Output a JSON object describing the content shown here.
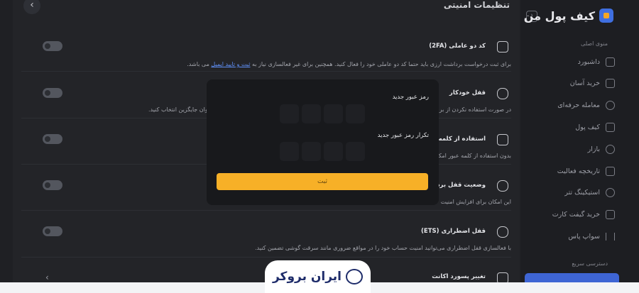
{
  "header": {
    "page_title": "تنظیمات امنیتی",
    "back_icon": "chevron-left-icon",
    "brand_name": "کیف پول من",
    "collapse_icon": "chevron-right-icon"
  },
  "sidebar": {
    "section_title": "منوی اصلی",
    "items": [
      {
        "label": "داشبورد",
        "icon": "grid-icon"
      },
      {
        "label": "خرید آسان",
        "icon": "chart-icon"
      },
      {
        "label": "معامله حرفه‌ای",
        "icon": "exchange-icon"
      },
      {
        "label": "کیف پول",
        "icon": "wallet-icon"
      },
      {
        "label": "بازار",
        "icon": "market-icon"
      },
      {
        "label": "تاریخچه فعالیت",
        "icon": "history-icon"
      },
      {
        "label": "استیکینگ تتر",
        "icon": "staking-icon"
      },
      {
        "label": "خرید گیفت کارت",
        "icon": "gift-icon"
      },
      {
        "label": "سواپ پاس",
        "icon": "swap-icon"
      }
    ],
    "quick_access_title": "دسترسی سریع"
  },
  "cards": [
    {
      "title": "کد دو عاملی (2FA)",
      "desc_before": "برای ثبت درخواست برداشت ارزی باید حتما کد دو عاملی خود را فعال کنید. همچنین برای غیر فعالسازی نیاز به ",
      "desc_link": "ثبت و تایید ایمیل",
      "desc_after": " می باشد."
    },
    {
      "title": "قفل خودکار",
      "desc": "در صورت استفاده نکردن از برنامه",
      "desc_tail": "ه به عنوان جایگزین انتخاب کنید."
    },
    {
      "title": "استفاده از کلمه عبور",
      "desc": "بدون استفاده از کلمه عبور امکان"
    },
    {
      "title": "وضعیت قفل برداشت",
      "desc": "این امکان برای افزایش امنیت"
    },
    {
      "title": "قفل اضطراری (ETS)",
      "desc": "با فعالسازی قفل اضطراری می‌توانید امنیت حساب خود را در مواقع ضروری مانند سرقت گوشی تضمین کنید."
    },
    {
      "title": "تغییر پسورد اکانت"
    }
  ],
  "modal": {
    "new_password_label": "رمز عبور جدید",
    "confirm_password_label": "تکرار رمز عبور جدید",
    "submit_label": "ثبت"
  },
  "watermark": {
    "text": "ایران بروکر"
  }
}
